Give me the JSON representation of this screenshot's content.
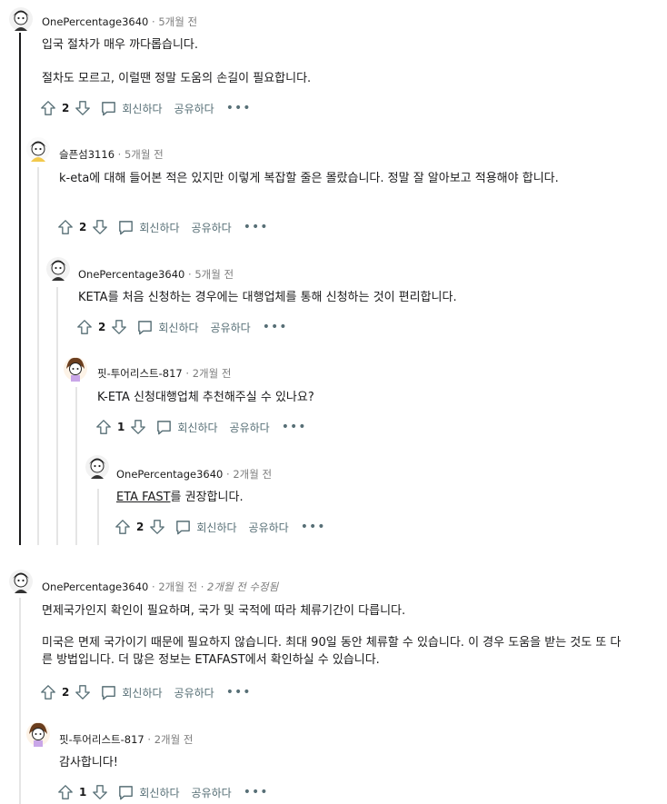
{
  "icons": {
    "upvote": "arrow-up-outline-icon",
    "downvote": "arrow-down-outline-icon",
    "reply": "speech-bubble-icon",
    "more": "ellipsis-icon"
  },
  "colors": {
    "thread_line_active": "#1a1a1b",
    "thread_line": "#e5e5e5",
    "meta_gray": "#7c7c7c",
    "action_gray": "#576f76"
  },
  "labels": {
    "reply": "회신하다",
    "share": "공유하다",
    "more": "•••",
    "separator": "·"
  },
  "comments": [
    {
      "user": "OnePercentage3640",
      "time": "5개월 전",
      "paragraphs": [
        "입국 절차가 매우 까다롭습니다.",
        "절차도 모르고, 이럴땐 정말 도움의 손길이 필요합니다."
      ],
      "votes": "2"
    },
    {
      "user": "슬픈섬3116",
      "time": "5개월 전",
      "paragraphs": [
        "k-eta에 대해 들어본 적은 있지만 이렇게 복잡할 줄은 몰랐습니다. 정말 잘 알아보고 적용해야 합니다."
      ],
      "votes": "2"
    },
    {
      "user": "OnePercentage3640",
      "time": "5개월 전",
      "paragraphs": [
        "KETA를 처음 신청하는 경우에는 대행업체를 통해 신청하는 것이 편리합니다."
      ],
      "votes": "2"
    },
    {
      "user": "핏-투어리스트-817",
      "time": "2개월 전",
      "paragraphs": [
        "K-ETA 신청대행업체 추천해주실 수 있나요?"
      ],
      "votes": "1"
    },
    {
      "user": "OnePercentage3640",
      "time": "2개월 전",
      "link_text": "ETA FAST",
      "after_link": "를 권장합니다.",
      "votes": "2"
    },
    {
      "user": "OnePercentage3640",
      "time": "2개월 전",
      "edited": "2개월 전 수정됨",
      "paragraphs": [
        "면제국가인지 확인이 필요하며, 국가 및 국적에 따라 체류기간이 다릅니다.",
        "미국은 면제 국가이기 때문에 필요하지 않습니다. 최대 90일 동안 체류할 수 있습니다. 이 경우 도움을 받는 것도 또 다른 방법입니다. 더 많은 정보는 ETAFAST에서 확인하실 수 있습니다."
      ],
      "votes": "2"
    },
    {
      "user": "핏-투어리스트-817",
      "time": "2개월 전",
      "paragraphs": [
        "감사합니다!"
      ],
      "votes": "1"
    }
  ]
}
